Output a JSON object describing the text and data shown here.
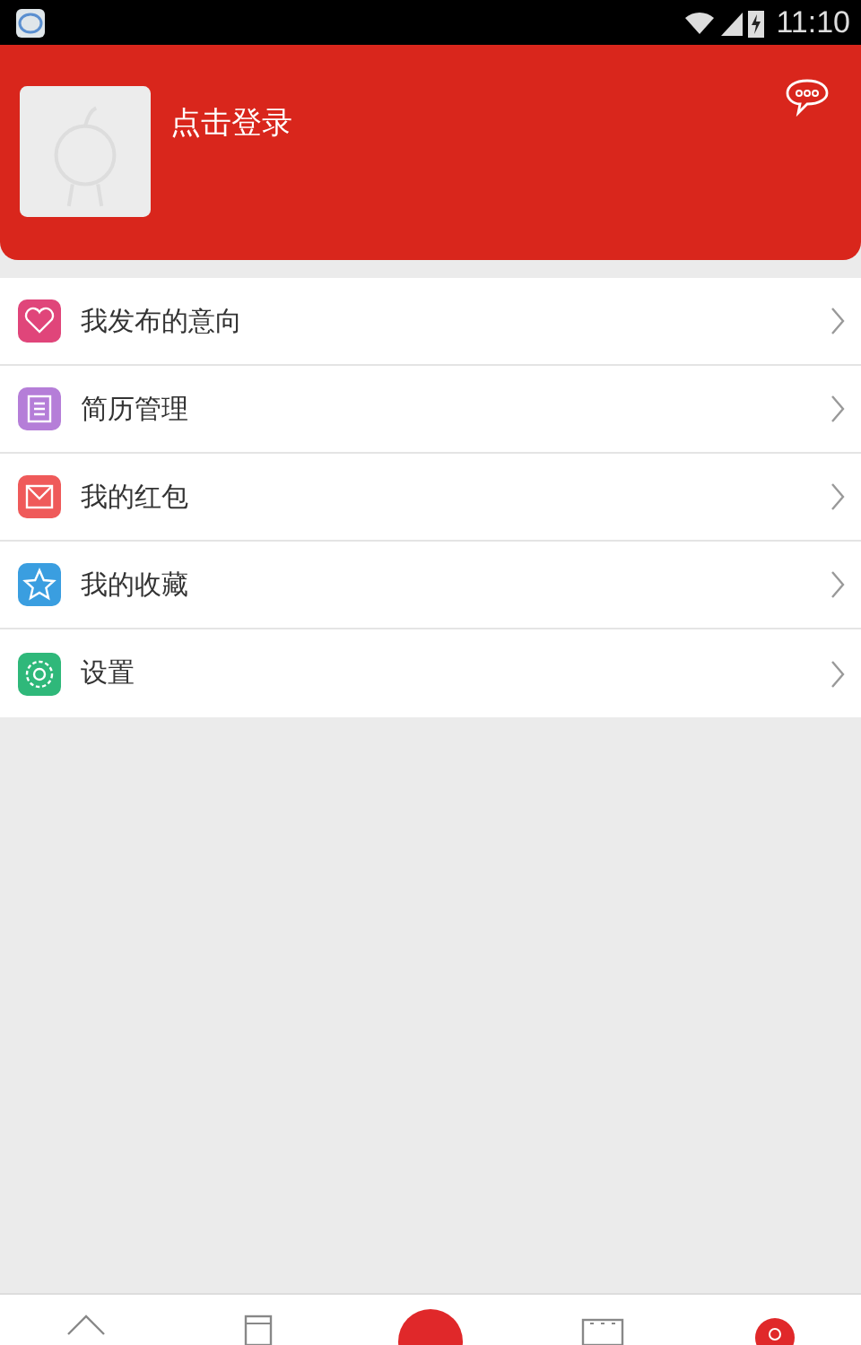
{
  "status_bar": {
    "time": "11:10"
  },
  "header": {
    "login_label": "点击登录"
  },
  "menu": [
    {
      "label": "我发布的意向",
      "kind": "heart",
      "color": "#e0457a"
    },
    {
      "label": "简历管理",
      "kind": "clipboard",
      "color": "#b57ed8"
    },
    {
      "label": "我的红包",
      "kind": "envelope",
      "color": "#ef5a5a"
    },
    {
      "label": "我的收藏",
      "kind": "star",
      "color": "#3a9ee0"
    },
    {
      "label": "设置",
      "kind": "gear",
      "color": "#2fb87a"
    }
  ],
  "bottom_nav": [
    {
      "kind": "home",
      "selected": false
    },
    {
      "kind": "list",
      "selected": false
    },
    {
      "kind": "publish",
      "selected": false
    },
    {
      "kind": "calendar",
      "selected": false
    },
    {
      "kind": "profile",
      "selected": true
    }
  ]
}
